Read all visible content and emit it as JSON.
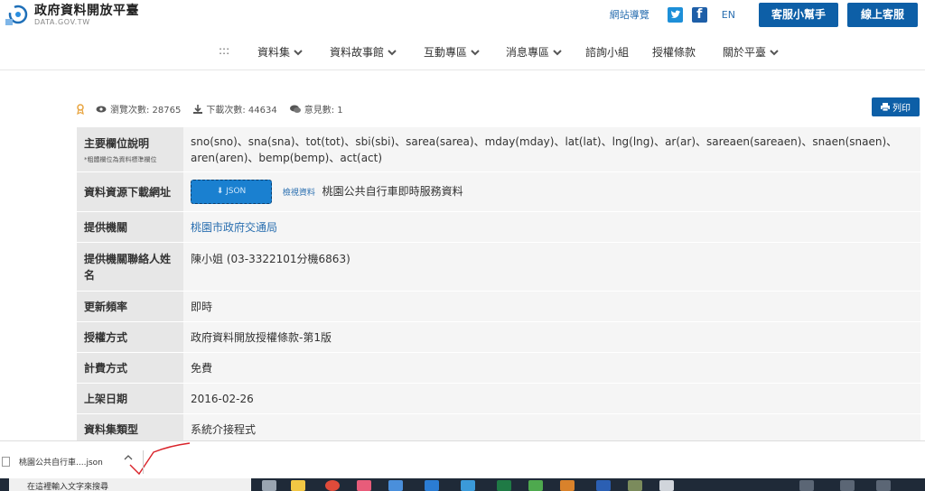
{
  "header": {
    "logo_title": "政府資料開放平臺",
    "logo_sub": "DATA.GOV.TW",
    "sitemap": "網站導覽",
    "lang": "EN",
    "helper_btn": "客服小幫手",
    "online_btn": "線上客服"
  },
  "nav": {
    "items": [
      {
        "label": ":::"
      },
      {
        "label": "資料集"
      },
      {
        "label": "資料故事館"
      },
      {
        "label": "互動專區"
      },
      {
        "label": "消息專區"
      },
      {
        "label": "諮詢小組"
      },
      {
        "label": "授權條款"
      },
      {
        "label": "關於平臺"
      }
    ]
  },
  "stats": {
    "views": "瀏覽次數: 28765",
    "downloads": "下載次數: 44634",
    "comments": "意見數: 1",
    "print": "列印"
  },
  "table": {
    "fields_label": "主要欄位說明",
    "fields_note": "*粗體欄位為資料標準欄位",
    "fields_value": "sno(sno)、sna(sna)、tot(tot)、sbi(sbi)、sarea(sarea)、mday(mday)、lat(lat)、lng(lng)、ar(ar)、sareaen(sareaen)、snaen(snaen)、aren(aren)、bemp(bemp)、act(act)",
    "resource_label": "資料資源下載網址",
    "resource_btn": "JSON",
    "resource_view": "檢視資料",
    "resource_name": "桃園公共自行車即時服務資料",
    "provider_label": "提供機關",
    "provider_value": "桃園市政府交通局",
    "contact_label": "提供機關聯絡人姓名",
    "contact_value": "陳小姐 (03-3322101分機6863)",
    "freq_label": "更新頻率",
    "freq_value": "即時",
    "license_label": "授權方式",
    "license_value": "政府資料開放授權條款-第1版",
    "fee_label": "計費方式",
    "fee_value": "免費",
    "date_label": "上架日期",
    "date_value": "2016-02-26",
    "type_label": "資料集類型",
    "type_value": "系統介接程式"
  },
  "download_bar": {
    "file": "桃園公共自行車....json"
  },
  "taskbar": {
    "search": "在這裡輸入文字來搜尋"
  }
}
